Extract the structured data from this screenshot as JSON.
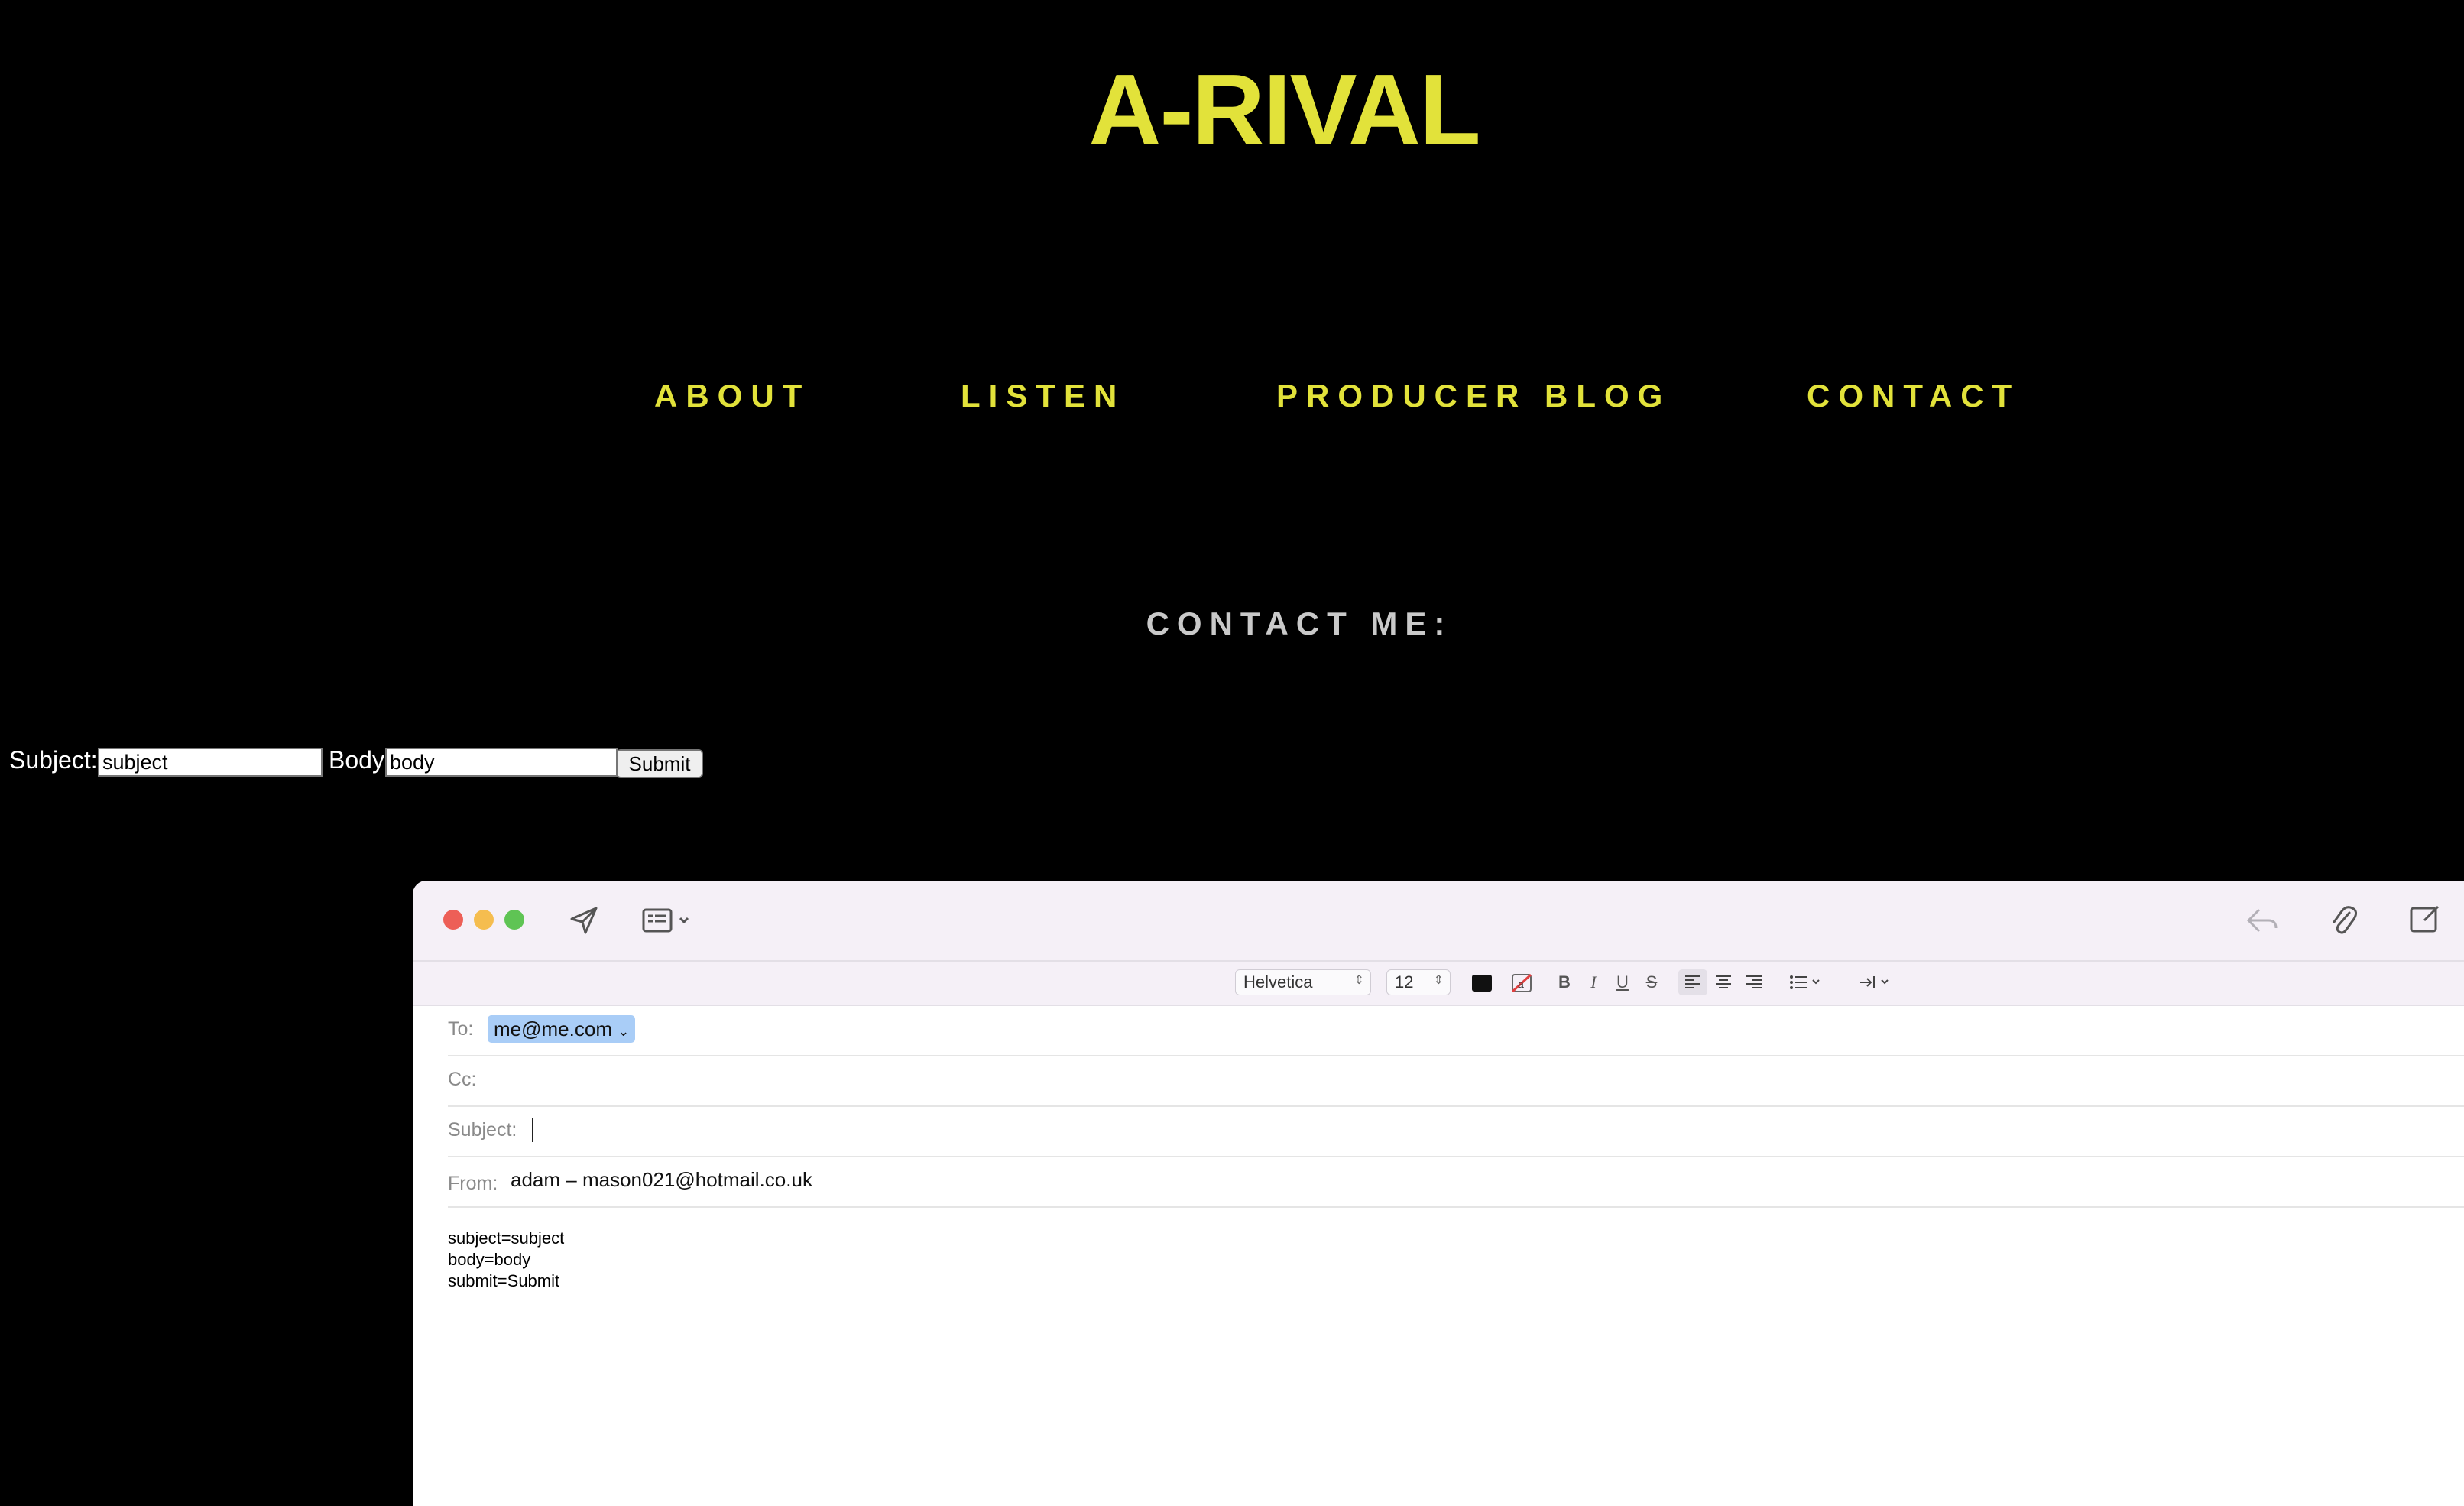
{
  "site": {
    "title": "A-RIVAL",
    "nav": [
      "ABOUT",
      "LISTEN",
      "PRODUCER BLOG",
      "CONTACT"
    ],
    "contact_heading": "CONTACT ME:",
    "form": {
      "subject_label": "Subject:",
      "subject_value": "subject",
      "body_label": "Body",
      "body_value": "body",
      "submit_label": "Submit"
    },
    "colors": {
      "background": "#000000",
      "accent": "#e2e23a"
    }
  },
  "mail": {
    "format_bar": {
      "font": "Helvetica",
      "size": "12",
      "bold": "B",
      "italic": "I",
      "underline": "U",
      "strike": "S"
    },
    "headers": {
      "to_label": "To:",
      "to_value": "me@me.com",
      "cc_label": "Cc:",
      "subject_label": "Subject:",
      "from_label": "From:",
      "from_value": "adam – mason021@hotmail.co.uk"
    },
    "body_lines": [
      "subject=subject",
      "body=body",
      "submit=Submit"
    ],
    "icons": [
      "send-icon",
      "header-fields-icon",
      "reply-icon",
      "attachment-icon",
      "compose-icon"
    ]
  }
}
